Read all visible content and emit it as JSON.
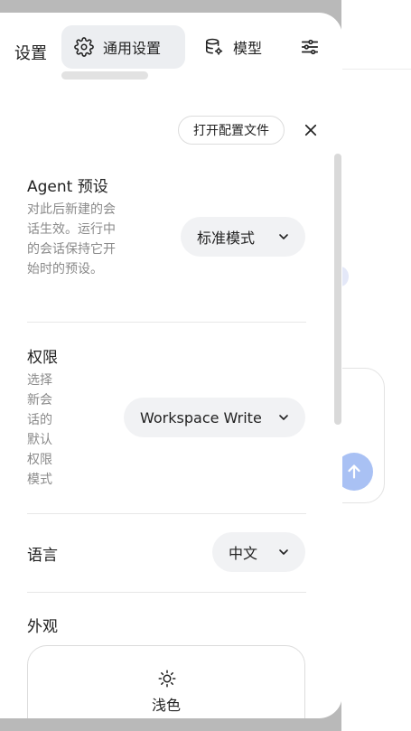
{
  "panel": {
    "title": "设置"
  },
  "tabs": [
    {
      "label": "通用设置",
      "icon": "gear-icon",
      "active": true
    },
    {
      "label": "模型",
      "icon": "database-gear-icon",
      "active": false
    },
    {
      "label": "",
      "icon": "sliders-icon",
      "active": false
    }
  ],
  "header": {
    "open_config_label": "打开配置文件",
    "close_icon": "close-icon"
  },
  "agent_preset": {
    "title": "Agent 预设",
    "description": "对此后新建的会话生效。运行中的会话保持它开始时的预设。",
    "value": "标准模式"
  },
  "permission": {
    "title": "权限",
    "description": "选择新会话的默认权限模式",
    "value": "Workspace Write"
  },
  "language": {
    "title": "语言",
    "value": "中文"
  },
  "appearance": {
    "title": "外观",
    "option_label": "浅色",
    "option_icon": "sun-icon"
  },
  "colors": {
    "backdrop": "#b9b9b9",
    "select_bg": "#f1f2f4",
    "active_tab_bg": "#eceef1",
    "send_button": "#a9c1f4",
    "muted_text": "#8a8a8a"
  }
}
